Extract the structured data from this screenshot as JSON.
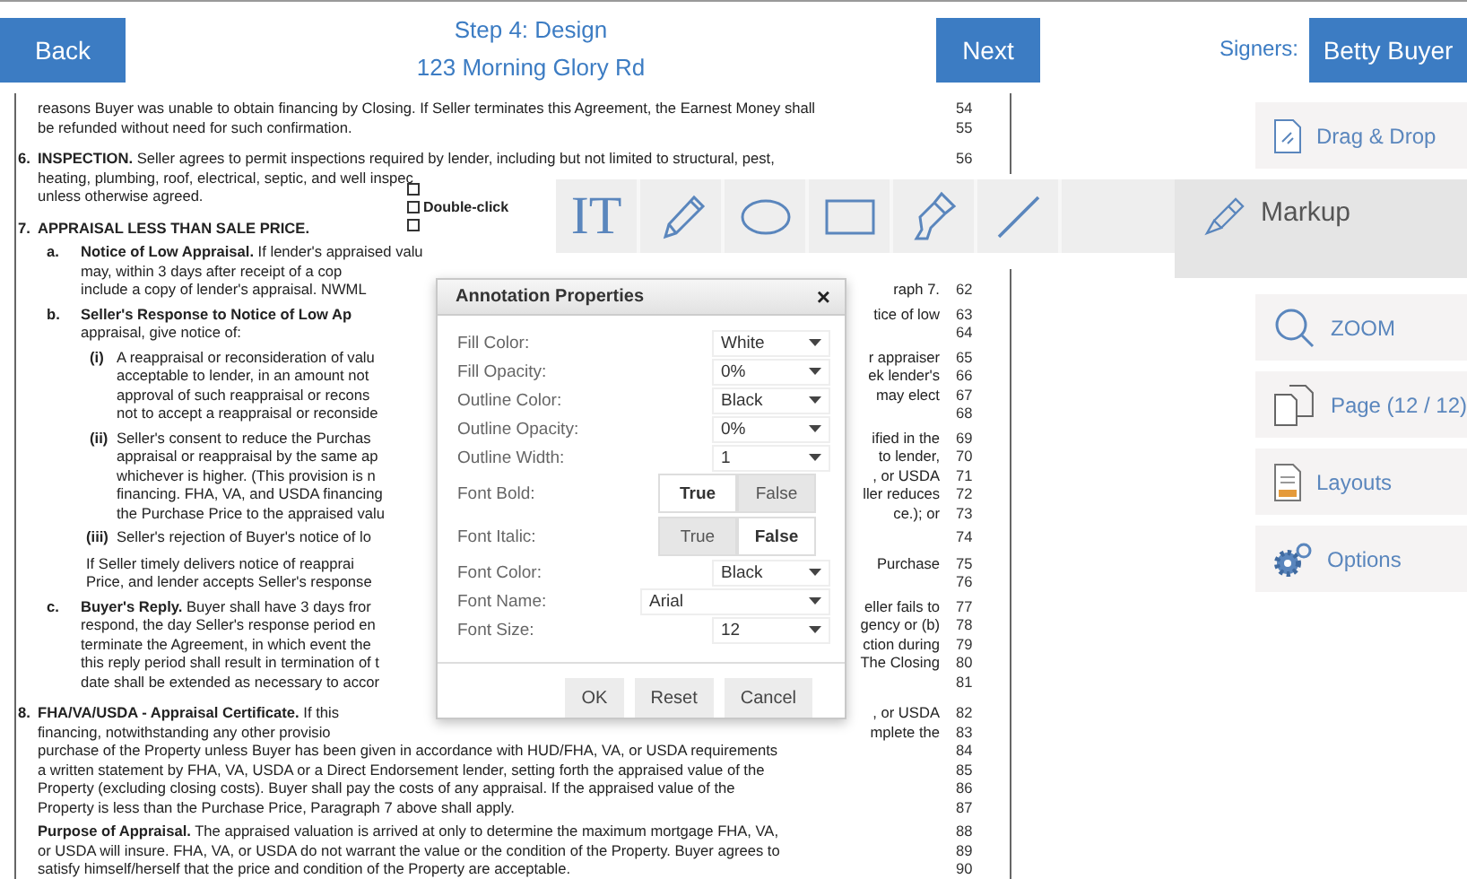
{
  "header": {
    "back": "Back",
    "step": "Step 4: Design",
    "address": "123 Morning Glory Rd",
    "next": "Next",
    "signers_label": "Signers:",
    "signer": "Betty Buyer"
  },
  "document": {
    "lines": [
      {
        "kind": "section_cont",
        "text": "reasons Buyer was unable to obtain financing by Closing. If Seller terminates this Agreement, the Earnest Money shall",
        "number": "54"
      },
      {
        "kind": "section_cont",
        "text": "be refunded without need for such confirmation.",
        "number": "55"
      },
      {
        "kind": "section",
        "marker": "6.",
        "text": "**INSPECTION.** Seller agrees to permit inspections required by lender, including but not limited to structural, pest,",
        "number": "56"
      },
      {
        "kind": "section_cont",
        "text": "heating, plumbing, roof, electrical, septic, and well inspec"
      },
      {
        "kind": "section_cont",
        "text": "unless otherwise agreed."
      },
      {
        "kind": "heading",
        "marker": "7.",
        "text": "APPRAISAL LESS THAN SALE PRICE."
      },
      {
        "kind": "item",
        "marker": "a.",
        "text": "**Notice of Low Appraisal.** If lender's appraised valu"
      },
      {
        "kind": "item_cont",
        "text": "may, within 3 days after receipt of a cop"
      },
      {
        "kind": "item_cont",
        "text": "include a copy of lender's appraisal. NWML",
        "right": "raph 7.",
        "number": "62"
      },
      {
        "kind": "item",
        "marker": "b.",
        "text": "**Seller's Response to Notice of Low Ap**",
        "right": "tice of low",
        "number": "63"
      },
      {
        "kind": "item_cont",
        "text": "appraisal, give notice of:",
        "number": "64"
      },
      {
        "kind": "sub",
        "marker": "(i)",
        "text": "A reappraisal or reconsideration of valu",
        "right": "r appraiser",
        "number": "65"
      },
      {
        "kind": "sub_cont",
        "text": "acceptable to lender, in an amount not",
        "right": "ek lender's",
        "number": "66"
      },
      {
        "kind": "sub_cont",
        "text": "approval of such reappraisal or recons",
        "right": "may elect",
        "number": "67"
      },
      {
        "kind": "sub_cont",
        "text": "not to accept a reappraisal or reconside",
        "number": "68"
      },
      {
        "kind": "sub",
        "marker": "(ii)",
        "text": "Seller's consent to reduce the Purchas",
        "right": "ified in the",
        "number": "69"
      },
      {
        "kind": "sub_cont",
        "text": "appraisal or reappraisal by the same ap",
        "right": "to lender,",
        "number": "70"
      },
      {
        "kind": "sub_cont",
        "text": "whichever is higher. (This provision is n",
        "right": ", or USDA",
        "number": "71"
      },
      {
        "kind": "sub_cont",
        "text": "financing. FHA, VA, and USDA financing",
        "right": "ller reduces",
        "number": "72"
      },
      {
        "kind": "sub_cont",
        "text": "the Purchase Price to the appraised valu",
        "right": "ce.); or",
        "number": "73"
      },
      {
        "kind": "sub3",
        "marker": "(iii)",
        "text": "Seller's rejection of Buyer's notice of lo",
        "number": "74"
      },
      {
        "kind": "para",
        "text": "If Seller timely delivers notice of reapprai",
        "right": "Purchase",
        "number": "75"
      },
      {
        "kind": "para_cont",
        "text": "Price, and lender accepts Seller's response",
        "number": "76"
      },
      {
        "kind": "item",
        "marker": "c.",
        "text": "**Buyer's Reply.** Buyer shall have 3 days fror",
        "right": "eller fails to",
        "number": "77"
      },
      {
        "kind": "item_cont",
        "text": "respond, the day Seller's response period en",
        "right": "gency or (b)",
        "number": "78"
      },
      {
        "kind": "item_cont",
        "text": "terminate the Agreement, in which event the",
        "right": "ction during",
        "number": "79"
      },
      {
        "kind": "item_cont",
        "text": "this reply period shall result in termination of t",
        "right": "The Closing",
        "number": "80"
      },
      {
        "kind": "item_cont",
        "text": "date shall be extended as necessary to accor",
        "number": "81"
      },
      {
        "kind": "section",
        "marker": "8.",
        "text": "**FHA/VA/USDA - Appraisal Certificate.** If this",
        "right": ", or USDA",
        "number": "82"
      },
      {
        "kind": "section_cont",
        "text": "financing, notwithstanding any other provisio",
        "right": "mplete the",
        "number": "83"
      },
      {
        "kind": "section_cont",
        "text": "purchase of the Property unless Buyer has been given in accordance with HUD/FHA, VA, or USDA requirements",
        "number": "84"
      },
      {
        "kind": "section_cont",
        "text": "a written statement by FHA, VA, USDA or a Direct Endorsement lender, setting forth the appraised value of the",
        "number": "85"
      },
      {
        "kind": "section_cont",
        "text": "Property (excluding closing costs). Buyer shall pay the costs of any appraisal. If the appraised value of the",
        "number": "86"
      },
      {
        "kind": "section_cont",
        "text": "Property is less than the Purchase Price, Paragraph 7 above shall apply.",
        "number": "87"
      },
      {
        "kind": "section_para",
        "text": "**Purpose of Appraisal.** The appraised valuation is arrived at only to determine the maximum mortgage FHA, VA,",
        "number": "88"
      },
      {
        "kind": "section_cont",
        "text": "or USDA will insure. FHA, VA, or USDA do not warrant the value or the condition of the Property. Buyer agrees to",
        "number": "89"
      },
      {
        "kind": "section_cont",
        "text": "satisfy himself/herself that the price and condition of the Property are acceptable.",
        "number": "90"
      }
    ]
  },
  "annotation": {
    "text": "Double-click"
  },
  "toolbar": {
    "tools": [
      {
        "kind": "text",
        "glyph": "IT"
      },
      {
        "kind": "pen"
      },
      {
        "kind": "ellipse"
      },
      {
        "kind": "rectangle"
      },
      {
        "kind": "highlighter"
      },
      {
        "kind": "line"
      }
    ],
    "tab": {
      "label": "Markup",
      "selected": true
    }
  },
  "sidebar": {
    "top": [
      {
        "kind": "drag",
        "label": "Drag & Drop"
      }
    ],
    "bottom": [
      {
        "kind": "zoom",
        "label": "ZOOM"
      },
      {
        "kind": "page",
        "label": "Page (12 / 12)"
      },
      {
        "kind": "layouts",
        "label": "Layouts"
      },
      {
        "kind": "options",
        "label": "Options"
      }
    ]
  },
  "dialog": {
    "title": "Annotation Properties",
    "close": "×",
    "fields": [
      {
        "kind": "select",
        "label": "Fill Color:",
        "value": "White"
      },
      {
        "kind": "select",
        "label": "Fill Opacity:",
        "value": "0%"
      },
      {
        "kind": "select",
        "label": "Outline Color:",
        "value": "Black"
      },
      {
        "kind": "select",
        "label": "Outline Opacity:",
        "value": "0%"
      },
      {
        "kind": "select",
        "label": "Outline Width:",
        "value": "1"
      },
      {
        "kind": "toggle",
        "label": "Font Bold:",
        "options": [
          {
            "label": "True",
            "selected": true
          },
          {
            "label": "False",
            "selected": false
          }
        ]
      },
      {
        "kind": "toggle",
        "label": "Font Italic:",
        "options": [
          {
            "label": "True",
            "selected": false
          },
          {
            "label": "False",
            "selected": true
          }
        ]
      },
      {
        "kind": "select",
        "label": "Font Color:",
        "value": "Black"
      },
      {
        "kind": "wide_select",
        "label": "Font Name:",
        "value": "Arial"
      },
      {
        "kind": "select",
        "label": "Font Size:",
        "value": "12"
      }
    ],
    "buttons": [
      "OK",
      "Reset",
      "Cancel"
    ]
  }
}
